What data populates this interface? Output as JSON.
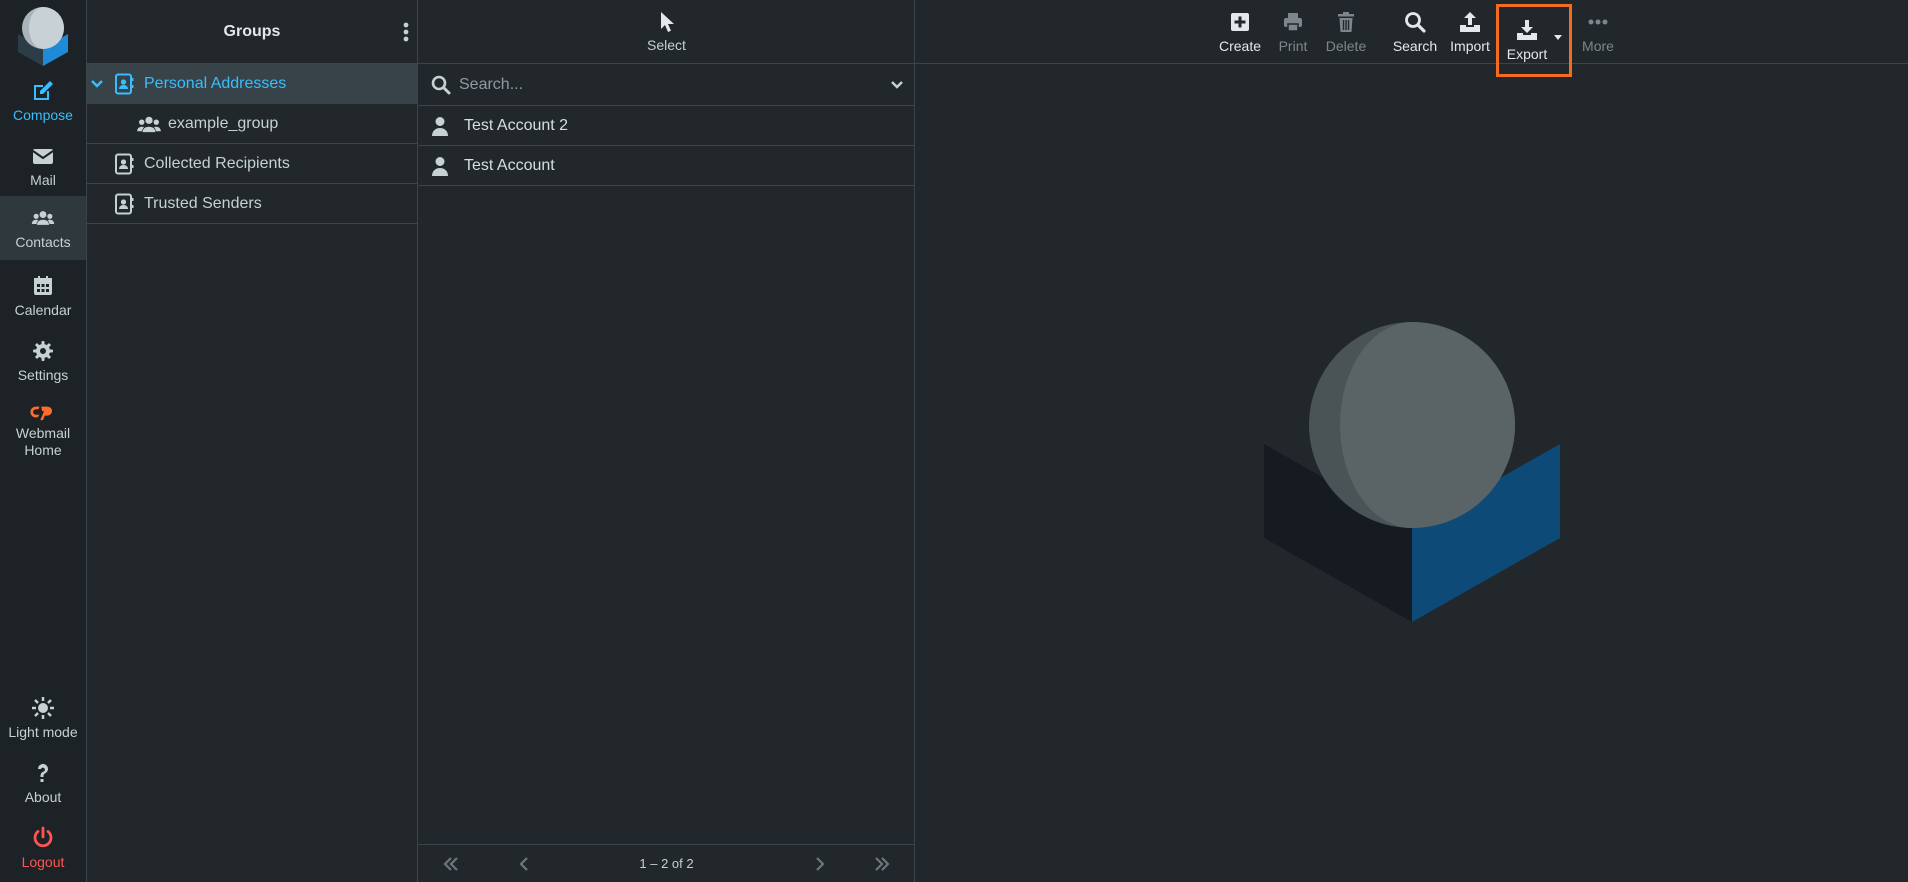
{
  "nav": {
    "items": [
      {
        "id": "compose",
        "label": "Compose",
        "icon": "compose-icon"
      },
      {
        "id": "mail",
        "label": "Mail",
        "icon": "envelope-icon"
      },
      {
        "id": "contacts",
        "label": "Contacts",
        "icon": "users-icon",
        "active": true
      },
      {
        "id": "calendar",
        "label": "Calendar",
        "icon": "calendar-icon"
      },
      {
        "id": "settings",
        "label": "Settings",
        "icon": "gear-icon"
      },
      {
        "id": "webmail",
        "label": "Webmail Home",
        "icon": "cpanel-icon"
      }
    ],
    "bottom": [
      {
        "id": "lightmode",
        "label": "Light mode",
        "icon": "sun-icon"
      },
      {
        "id": "about",
        "label": "About",
        "icon": "question-icon"
      },
      {
        "id": "logout",
        "label": "Logout",
        "icon": "power-icon"
      }
    ]
  },
  "groups": {
    "title": "Groups",
    "items": [
      {
        "label": "Personal Addresses",
        "icon": "address-book-icon",
        "selected": true,
        "expanded": true
      },
      {
        "label": "example_group",
        "icon": "group-icon",
        "sub": true
      },
      {
        "label": "Collected Recipients",
        "icon": "address-book-icon"
      },
      {
        "label": "Trusted Senders",
        "icon": "address-book-icon"
      }
    ]
  },
  "list": {
    "select_label": "Select",
    "search_placeholder": "Search...",
    "contacts": [
      {
        "name": "Test Account 2"
      },
      {
        "name": "Test Account"
      }
    ],
    "pager": "1 – 2 of 2"
  },
  "toolbar": {
    "create": "Create",
    "print": "Print",
    "delete": "Delete",
    "search": "Search",
    "import": "Import",
    "export": "Export",
    "more": "More"
  },
  "colors": {
    "accent": "#37beff",
    "logout": "#ff5552",
    "highlight": "#f26d21",
    "cpanel": "#ff6c2c"
  }
}
